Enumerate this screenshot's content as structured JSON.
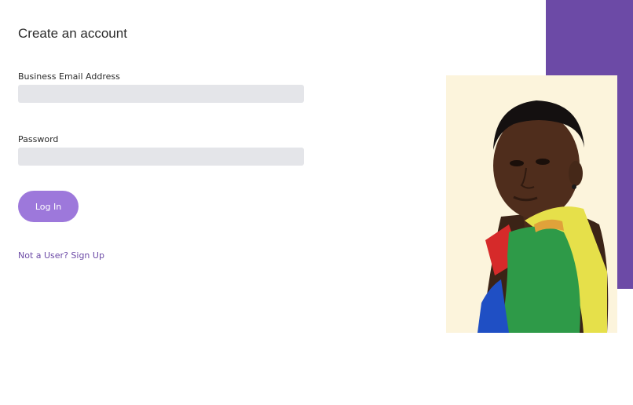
{
  "form": {
    "title": "Create an account",
    "email_label": "Business Email Address",
    "email_value": "",
    "email_placeholder": "",
    "password_label": "Password",
    "password_value": "",
    "password_placeholder": "",
    "login_label": "Log In",
    "signup_link": "Not a User? Sign Up"
  },
  "colors": {
    "accent": "#6c4aa6",
    "button": "#9d78db",
    "input_bg": "#e4e5e9",
    "photo_bg": "#fcf4dc"
  },
  "hero": {
    "image": "portrait-photo"
  }
}
